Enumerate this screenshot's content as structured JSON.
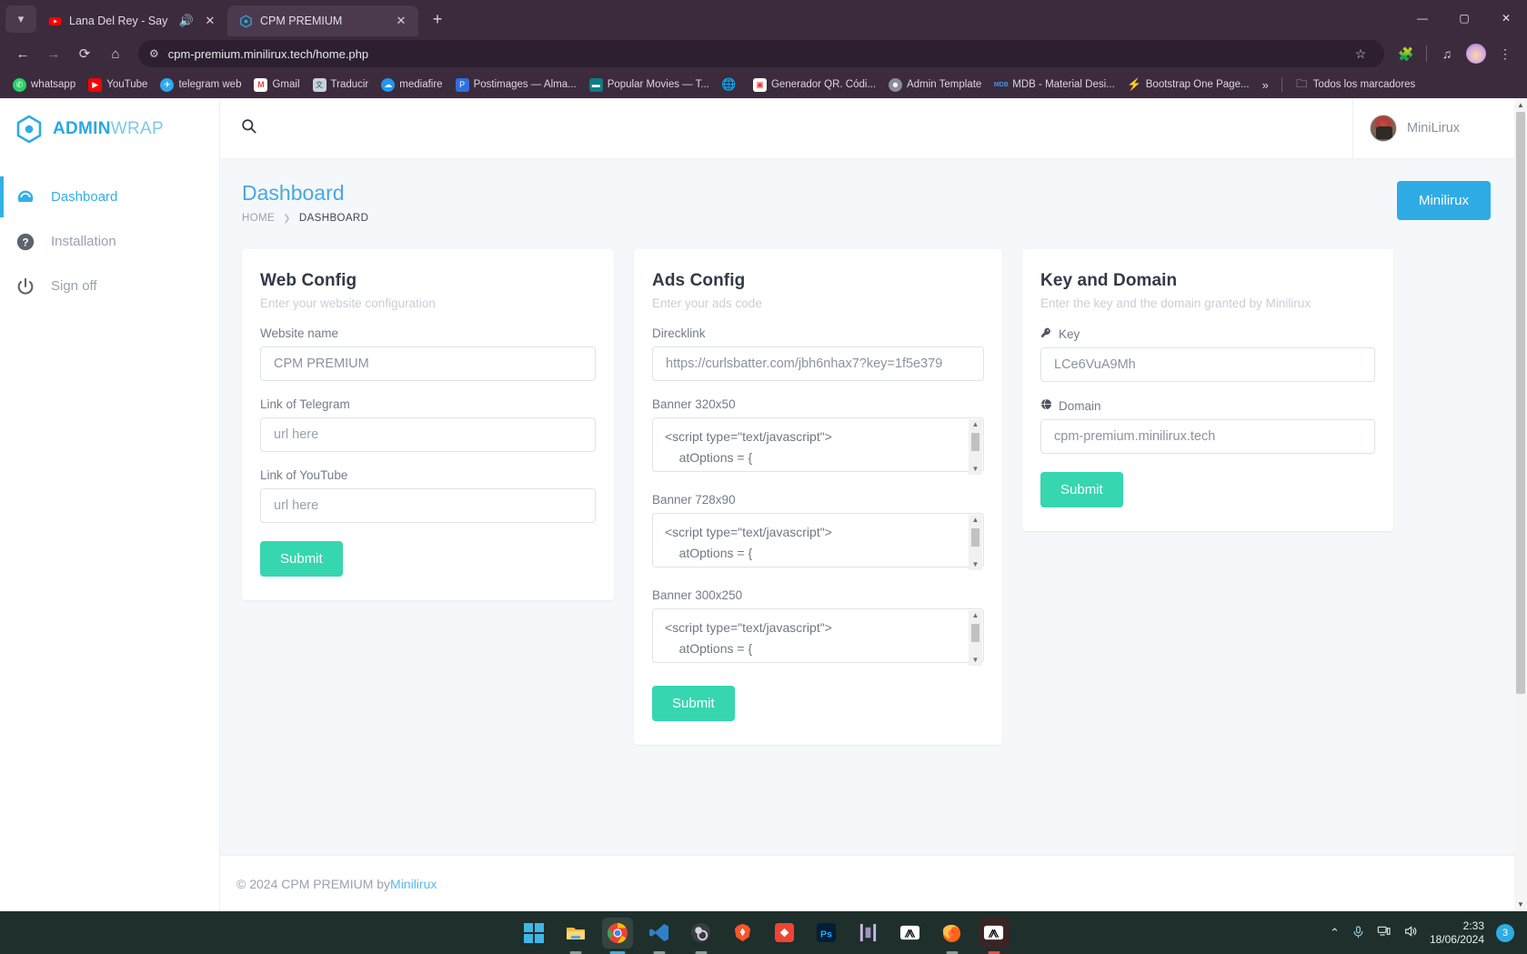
{
  "browser": {
    "tabs": [
      {
        "title": "Lana Del Rey - Say Yes To H",
        "favicon": "youtube-icon",
        "active": false,
        "audio": true
      },
      {
        "title": "CPM PREMIUM",
        "favicon": "adminwrap-icon",
        "active": true,
        "audio": false
      }
    ],
    "newtab_label": "+",
    "window_controls": {
      "minimize": "—",
      "maximize": "▢",
      "close": "✕"
    },
    "nav": {
      "back": "←",
      "forward": "→",
      "reload": "⟳",
      "home": "⌂"
    },
    "url": "cpm-premium.minilirux.tech/home.php",
    "toolbar_icons": [
      "bookmark-star-icon",
      "extensions-icon",
      "reading-list-icon",
      "profile-avatar-icon",
      "browser-menu-icon"
    ],
    "bookmarks": [
      {
        "label": "whatsapp",
        "color": "#25d366",
        "glyph": "✆"
      },
      {
        "label": "YouTube",
        "color": "#ff0000",
        "glyph": "▶"
      },
      {
        "label": "telegram web",
        "color": "#2aabee",
        "glyph": "✈"
      },
      {
        "label": "Gmail",
        "color": "#ffffff",
        "glyph": "M"
      },
      {
        "label": "Traducir",
        "color": "#b9c4d4",
        "glyph": "文"
      },
      {
        "label": "mediafire",
        "color": "#2196f3",
        "glyph": "☁"
      },
      {
        "label": "Postimages — Alma...",
        "color": "#2f6fe0",
        "glyph": "P"
      },
      {
        "label": "Popular Movies — T...",
        "color": "#0f7c86",
        "glyph": "▬"
      },
      {
        "label": "",
        "color": "#9aa2ad",
        "glyph": "🌐"
      },
      {
        "label": "Generador QR. Códi...",
        "color": "#e53935",
        "glyph": "▣"
      },
      {
        "label": "Admin Template",
        "color": "#5c5c6e",
        "glyph": "☻"
      },
      {
        "label": "MDB - Material Desi...",
        "color": "#1565c0",
        "glyph": "MDB"
      },
      {
        "label": "Bootstrap One Page...",
        "color": "#2196f3",
        "glyph": "⚡"
      }
    ],
    "bookmarks_overflow": "»",
    "all_bookmarks": "Todos los marcadores"
  },
  "sidebar": {
    "logo": {
      "bold": "ADMIN",
      "light": "WRAP",
      "icon": "hexagon-dot-icon"
    },
    "items": [
      {
        "label": "Dashboard",
        "icon": "speedometer-icon",
        "active": true
      },
      {
        "label": "Installation",
        "icon": "question-circle-icon",
        "active": false
      },
      {
        "label": "Sign off",
        "icon": "power-icon",
        "active": false
      }
    ]
  },
  "topbar": {
    "search_placeholder": "",
    "search_value": "",
    "search_icon": "search-icon",
    "user_name": "MiniLirux"
  },
  "page": {
    "title": "Dashboard",
    "breadcrumb": {
      "home": "HOME",
      "separator": "❯",
      "current": "DASHBOARD"
    },
    "brand_button": "Minilirux"
  },
  "web_config": {
    "title": "Web Config",
    "subtitle": "Enter your website configuration",
    "fields": [
      {
        "label": "Website name",
        "value": "CPM PREMIUM",
        "placeholder": ""
      },
      {
        "label": "Link of Telegram",
        "value": "",
        "placeholder": "url here"
      },
      {
        "label": "Link of YouTube",
        "value": "",
        "placeholder": "url here"
      }
    ],
    "submit": "Submit"
  },
  "ads_config": {
    "title": "Ads Config",
    "subtitle": "Enter your ads code",
    "direcklink": {
      "label": "Direcklink",
      "value": "https://curlsbatter.com/jbh6nhax7?key=1f5e379"
    },
    "banners": [
      {
        "label": "Banner 320x50",
        "value": "<script type=\"text/javascript\">\n    atOptions = {"
      },
      {
        "label": "Banner 728x90",
        "value": "<script type=\"text/javascript\">\n    atOptions = {"
      },
      {
        "label": "Banner 300x250",
        "value": "<script type=\"text/javascript\">\n    atOptions = {"
      }
    ],
    "submit": "Submit"
  },
  "key_domain": {
    "title": "Key and Domain",
    "subtitle": "Enter the key and the domain granted by Minilirux",
    "key": {
      "label": "Key",
      "icon": "key-icon",
      "value": "LCe6VuA9Mh"
    },
    "domain": {
      "label": "Domain",
      "icon": "globe-icon",
      "value": "cpm-premium.minilirux.tech"
    },
    "submit": "Submit"
  },
  "footer": {
    "text": "© 2024 CPM PREMIUM by ",
    "link": "Minilirux"
  },
  "taskbar": {
    "apps": [
      {
        "name": "windows-start-icon",
        "state": "none"
      },
      {
        "name": "file-explorer-icon",
        "state": "open"
      },
      {
        "name": "chrome-icon",
        "state": "active"
      },
      {
        "name": "vscode-icon",
        "state": "open"
      },
      {
        "name": "obs-icon",
        "state": "open"
      },
      {
        "name": "brave-icon",
        "state": "none"
      },
      {
        "name": "app-red-diamond-icon",
        "state": "none"
      },
      {
        "name": "photoshop-icon",
        "state": "none"
      },
      {
        "name": "capcut-bars-icon",
        "state": "none"
      },
      {
        "name": "capcut-icon",
        "state": "none"
      },
      {
        "name": "firefox-icon",
        "state": "open"
      },
      {
        "name": "capcut-dark-icon",
        "state": "red"
      }
    ],
    "tray": [
      "chevron-up-icon",
      "microphone-icon",
      "network-icon",
      "volume-icon"
    ],
    "clock": {
      "time": "2:33",
      "date": "18/06/2024"
    },
    "notification_count": "3"
  },
  "colors": {
    "accent": "#2fabe5",
    "submit": "#36d6b0",
    "chrome": "#3b2b3c",
    "page_bg": "#f4f8fa",
    "taskbar": "#1e2f2c"
  }
}
